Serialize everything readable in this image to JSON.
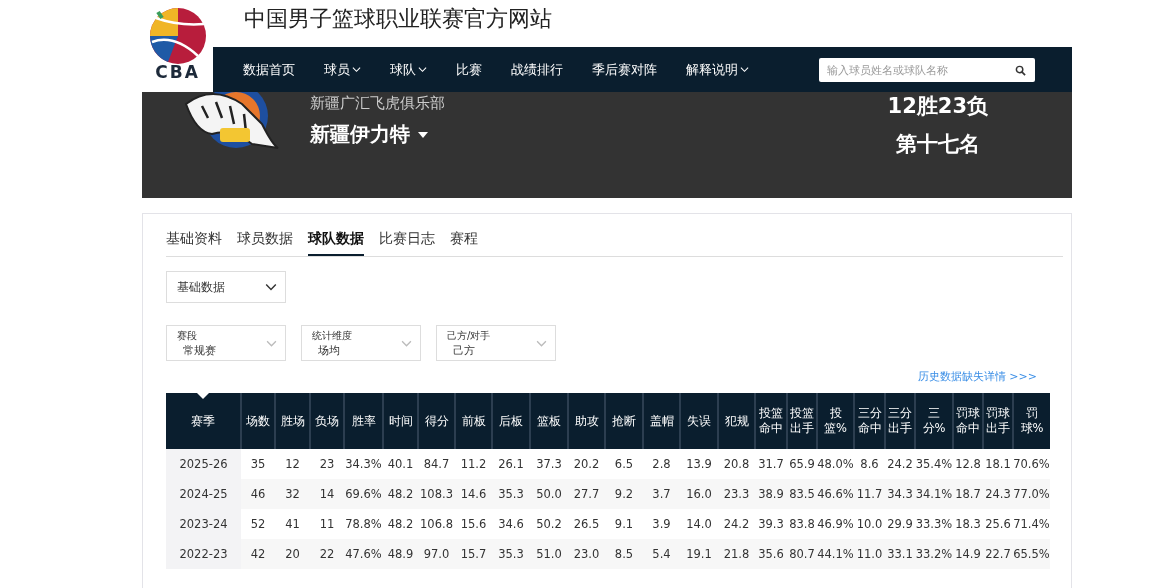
{
  "site": {
    "logo_text": "CBA",
    "title": "中国男子篮球职业联赛官方网站"
  },
  "nav": {
    "items": [
      {
        "label": "数据首页",
        "dropdown": false
      },
      {
        "label": "球员",
        "dropdown": true
      },
      {
        "label": "球队",
        "dropdown": true
      },
      {
        "label": "比赛",
        "dropdown": false
      },
      {
        "label": "战绩排行",
        "dropdown": false
      },
      {
        "label": "季后赛对阵",
        "dropdown": false
      },
      {
        "label": "解释说明",
        "dropdown": true
      }
    ],
    "search": {
      "placeholder": "输入球员姓名或球队名称"
    }
  },
  "team": {
    "club": "新疆广汇飞虎俱乐部",
    "name": "新疆伊力特",
    "record": "12胜23负",
    "rank": "第十七名"
  },
  "tabs": [
    {
      "label": "基础资料",
      "selected": false
    },
    {
      "label": "球员数据",
      "selected": false
    },
    {
      "label": "球队数据",
      "selected": true
    },
    {
      "label": "比赛日志",
      "selected": false
    },
    {
      "label": "赛程",
      "selected": false
    }
  ],
  "stat_type": {
    "value": "基础数据"
  },
  "filters": [
    {
      "label": "赛段",
      "value": "常规赛"
    },
    {
      "label": "统计维度",
      "value": "场均"
    },
    {
      "label": "己方/对手",
      "value": "己方"
    }
  ],
  "history_link": "历史数据缺失详情 >>>",
  "table": {
    "columns": [
      "赛季",
      "场数",
      "胜场",
      "负场",
      "胜率",
      "时间",
      "得分",
      "前板",
      "后板",
      "篮板",
      "助攻",
      "抢断",
      "盖帽",
      "失误",
      "犯规",
      "投篮命中",
      "投篮出手",
      "投篮%",
      "三分命中",
      "三分出手",
      "三分%",
      "罚球命中",
      "罚球出手",
      "罚球%"
    ],
    "rows": [
      [
        "2025-26",
        "35",
        "12",
        "23",
        "34.3%",
        "40.1",
        "84.7",
        "11.2",
        "26.1",
        "37.3",
        "20.2",
        "6.5",
        "2.8",
        "13.9",
        "20.8",
        "31.7",
        "65.9",
        "48.0%",
        "8.6",
        "24.2",
        "35.4%",
        "12.8",
        "18.1",
        "70.6%"
      ],
      [
        "2024-25",
        "46",
        "32",
        "14",
        "69.6%",
        "48.2",
        "108.3",
        "14.6",
        "35.3",
        "50.0",
        "27.7",
        "9.2",
        "3.7",
        "16.0",
        "23.3",
        "38.9",
        "83.5",
        "46.6%",
        "11.7",
        "34.3",
        "34.1%",
        "18.7",
        "24.3",
        "77.0%"
      ],
      [
        "2023-24",
        "52",
        "41",
        "11",
        "78.8%",
        "48.2",
        "106.8",
        "15.6",
        "34.6",
        "50.2",
        "26.5",
        "9.1",
        "3.9",
        "14.0",
        "24.2",
        "39.3",
        "83.8",
        "46.9%",
        "10.0",
        "29.9",
        "33.3%",
        "18.3",
        "25.6",
        "71.4%"
      ],
      [
        "2022-23",
        "42",
        "20",
        "22",
        "47.6%",
        "48.9",
        "97.0",
        "15.7",
        "35.3",
        "51.0",
        "23.0",
        "8.5",
        "5.4",
        "19.1",
        "21.8",
        "35.6",
        "80.7",
        "44.1%",
        "11.0",
        "33.1",
        "33.2%",
        "14.9",
        "22.7",
        "65.5%"
      ]
    ]
  }
}
